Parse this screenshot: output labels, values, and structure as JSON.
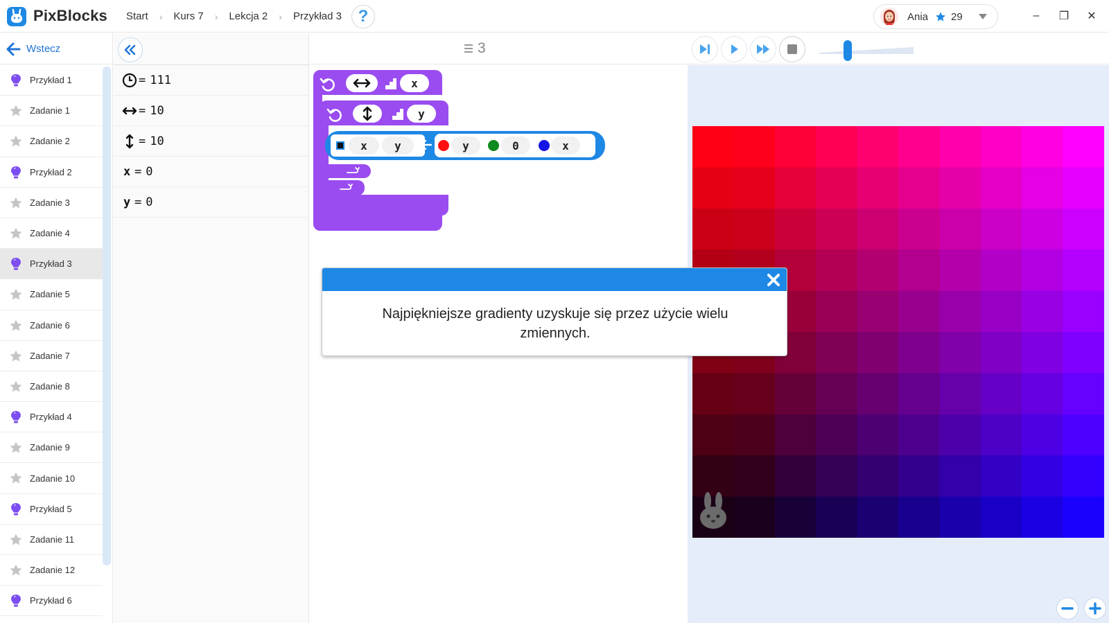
{
  "app": {
    "name": "PixBlocks"
  },
  "breadcrumb": [
    "Start",
    "Kurs 7",
    "Lekcja 2",
    "Przykład 3"
  ],
  "help_label": "?",
  "user": {
    "name": "Ania",
    "stars": "29"
  },
  "window_controls": {
    "minimize": "–",
    "maximize": "❐",
    "close": "✕"
  },
  "sidebar": {
    "back_label": "Wstecz",
    "items": [
      {
        "label": "Przykład 1",
        "icon": "lightbulb-icon"
      },
      {
        "label": "Zadanie 1",
        "icon": "star-icon"
      },
      {
        "label": "Zadanie 2",
        "icon": "star-icon"
      },
      {
        "label": "Przykład 2",
        "icon": "lightbulb-icon"
      },
      {
        "label": "Zadanie 3",
        "icon": "star-icon"
      },
      {
        "label": "Zadanie 4",
        "icon": "star-icon"
      },
      {
        "label": "Przykład 3",
        "icon": "lightbulb-icon",
        "active": true
      },
      {
        "label": "Zadanie 5",
        "icon": "star-icon"
      },
      {
        "label": "Zadanie 6",
        "icon": "star-icon"
      },
      {
        "label": "Zadanie 7",
        "icon": "star-icon"
      },
      {
        "label": "Zadanie 8",
        "icon": "star-icon"
      },
      {
        "label": "Przykład 4",
        "icon": "lightbulb-icon"
      },
      {
        "label": "Zadanie 9",
        "icon": "star-icon"
      },
      {
        "label": "Zadanie 10",
        "icon": "star-icon"
      },
      {
        "label": "Przykład 5",
        "icon": "lightbulb-icon"
      },
      {
        "label": "Zadanie 11",
        "icon": "star-icon"
      },
      {
        "label": "Zadanie 12",
        "icon": "star-icon"
      },
      {
        "label": "Przykład 6",
        "icon": "lightbulb-icon"
      }
    ]
  },
  "variables": [
    {
      "icon": "clock-icon",
      "name": "",
      "eq": "=",
      "value": "111"
    },
    {
      "icon": "horizontal-arrows-icon",
      "name": "",
      "eq": "=",
      "value": "10"
    },
    {
      "icon": "vertical-arrows-icon",
      "name": "",
      "eq": "=",
      "value": "10"
    },
    {
      "icon": "",
      "name": "x",
      "eq": "=",
      "value": "0"
    },
    {
      "icon": "",
      "name": "y",
      "eq": "=",
      "value": "0"
    }
  ],
  "code": {
    "line_count": "3",
    "outer_loop_var": "x",
    "inner_loop_var": "y",
    "assign_target_x": "x",
    "assign_target_y": "y",
    "red_arg": "y",
    "green_arg": "0",
    "blue_arg": "x"
  },
  "colors": {
    "block_purple": "#9a4cf0",
    "assign_blue": "#1e88e5",
    "accent_blue": "#1e88e5",
    "stage_bg": "#e5edfb",
    "red_dot": "#ff1010",
    "green_dot": "#0f8a1e",
    "blue_dot": "#1414e6"
  },
  "stage": {
    "grid_size": 10,
    "speed_level": 0.3
  },
  "hint": {
    "text": "Najpiękniejsze gradienty uzyskuje się przez użycie wielu zmiennych."
  }
}
